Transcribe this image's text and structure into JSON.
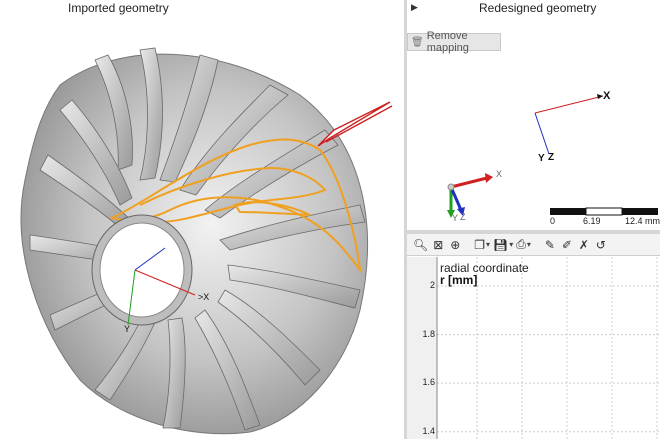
{
  "left_pane": {
    "title": "Imported geometry"
  },
  "right_pane": {
    "title": "Redesigned geometry",
    "remove_mapping_label": "Remove mapping",
    "axes": {
      "x": "X",
      "y": "Y",
      "z": "Z"
    },
    "triad": {
      "x": "X",
      "y": "Y",
      "z": "Z"
    },
    "scalebar": {
      "ticks": [
        "0",
        "6.19",
        "12.4 mm"
      ]
    }
  },
  "chart_data": {
    "type": "line",
    "title": "radial coordinate",
    "ylabel": "r [mm]",
    "yticks": [
      "2",
      "1.8",
      "1.6",
      "1.4"
    ],
    "ylim": [
      1.3,
      2.0
    ],
    "series": []
  },
  "toolbar_icons": [
    "zoom-icon",
    "zoom-fit-icon",
    "pan-icon",
    "copy-icon",
    "save-icon",
    "print-icon",
    "edit-icon",
    "edit-points-icon",
    "reset-icon",
    "more-icon"
  ],
  "colors": {
    "highlight": "#f0a020",
    "arrow": "#cc2020",
    "axis_x": "#d02020",
    "axis_y": "#20a020",
    "axis_z": "#2030c0"
  }
}
